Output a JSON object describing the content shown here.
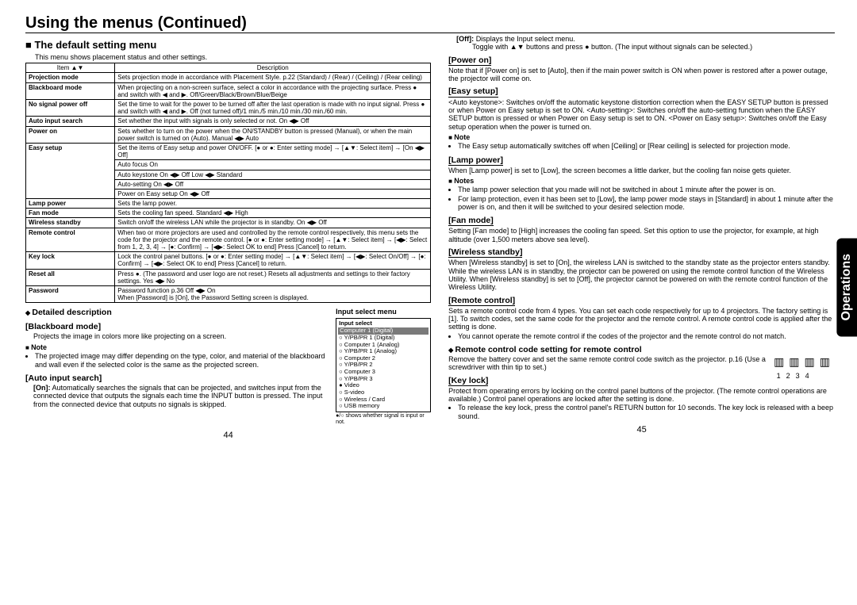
{
  "title": "Using the menus (Continued)",
  "section": "The default setting menu",
  "intro": "This menu shows placement status and other settings.",
  "thead_item": "Item ▲▼",
  "thead_desc": "Description",
  "rows": {
    "r0i": "Projection mode",
    "r0d": "Sets projection mode in accordance with Placement Style. p.22  (Standard) / (Rear) / (Ceiling) / (Rear ceiling)",
    "r1i": "Blackboard mode",
    "r1d": "When projecting on a non-screen surface, select a color in accordance with the projecting surface. Press ● and switch with ◀ and ▶. Off/Green/Black/Brown/Blue/Beige",
    "r2i": "No signal power off",
    "r2d": "Set the time to wait for the power to be turned off after the last operation is made with no input signal. Press ● and switch with ◀ and ▶. Off (not turned off)/1 min./5 min./10 min./30 min./60 min.",
    "r3i": "Auto input search",
    "r3d": "Set whether the input with signals is only selected or not.        On ◀▶ Off",
    "r4i": "Power on",
    "r4d": "Sets whether to turn on the power when the ON/STANDBY button is pressed (Manual), or when the main power switch is turned on (Auto).   Manual ◀▶ Auto",
    "r5i": "Easy setup",
    "r5d": "Set the items of Easy setup and power ON/OFF. [● or ●: Enter setting mode] → [▲▼: Select item] → [On ◀▶ Off]",
    "r5a": "Auto focus           On",
    "r5b": "Auto keystone     On ◀▶ Off              Low ◀▶ Standard",
    "r5c": "Auto-setting         On ◀▶ Off",
    "r5d2": "Power on Easy setup   On ◀▶ Off",
    "r6i": "Lamp power",
    "r6d": "Sets the lamp power.",
    "r7i": "Fan mode",
    "r7d": "Sets the cooling fan speed.                         Standard ◀▶ High",
    "r8i": "Wireless standby",
    "r8d": "Switch on/off the wireless LAN while the projector is in standby.    On ◀▶ Off",
    "r9i": "Remote control",
    "r9d": "When two or more projectors are used and controlled by the remote control respectively, this menu sets the code for the projector and the remote control. [● or ●: Enter setting mode] → [▲▼: Select item] → [◀▶: Select from 1, 2, 3, 4] → [●: Confirm] → [◀▶: Select OK to end] Press [Cancel] to return.",
    "r10i": "Key lock",
    "r10d": "Lock the control panel buttons. [● or ●: Enter setting mode] → [▲▼: Select item] → [◀▶: Select On/Off] → [●: Confirm] → [◀▶: Select OK to end] Press [Cancel] to return.",
    "r11i": "Reset all",
    "r11d": "Press ●. (The password and user logo are not reset.) Resets all adjustments and settings to their factory settings.   Yes ◀▶ No",
    "r12i": "Password",
    "r12d": "Password function p.36                                    Off ◀▶ On\nWhen [Password] is [On], the Password Setting screen is displayed."
  },
  "detdesc": "Detailed description",
  "bb": {
    "h": "[Blackboard mode]",
    "p": "Projects the image in colors more like projecting on a screen."
  },
  "noteh": "Note",
  "bb_note": "The projected image may differ depending on the type, color, and material of the blackboard and wall even if the selected color is the same as the projected screen.",
  "ais": {
    "h": "[Auto input search]",
    "on": "[On]:",
    "ont": "Automatically searches the signals that can be projected, and switches input from the connected device that outputs the signals each time the INPUT button is pressed. The input from the connected device that outputs no signals is skipped.",
    "off": "[Off]:",
    "offt": "Displays the Input select menu.",
    "toggle": "Toggle with ▲▼ buttons and press ● button. (The input without signals can be selected.)"
  },
  "inputmenu": {
    "title": "Input select menu",
    "hdr": "Input select",
    "i0": "Computer 1 (Digital)",
    "i1": "Y/PB/PR 1 (Digital)",
    "i2": "Computer 1 (Analog)",
    "i3": "Y/PB/PR 1 (Analog)",
    "i4": "Computer 2",
    "i5": "Y/PB/PR 2",
    "i6": "Computer 3",
    "i7": "Y/PB/PR 3",
    "i8": "Video",
    "i9": "S-video",
    "i10": "Wireless / Card",
    "i11": "USB memory",
    "foot": "●/○ shows whether signal is input or not."
  },
  "right": {
    "poweron": {
      "h": "[Power on]",
      "p": "Note that if [Power on] is set to [Auto], then if the main power switch is ON when power is restored after a power outage, the projector will come on."
    },
    "easy": {
      "h": "[Easy setup]",
      "p": "<Auto keystone>: Switches on/off the automatic keystone distortion correction when the EASY SETUP button is pressed or when Power on Easy setup is set to ON. <Auto-setting>: Switches on/off the auto-setting function when the EASY SETUP button is pressed or when Power on Easy setup is set to ON. <Power on Easy setup>: Switches on/off the Easy setup operation when the power is turned on.",
      "note": "The Easy setup automatically switches off when [Ceiling] or [Rear ceiling] is selected for projection mode."
    },
    "lamp": {
      "h": "[Lamp power]",
      "p": "When [Lamp power] is set to [Low], the screen becomes a little darker, but the cooling fan noise gets quieter.",
      "n1": "The lamp power selection that you made will not be switched in about 1 minute after the power is on.",
      "n2": "For lamp protection, even it has been set to [Low], the lamp power mode stays in [Standard] in about 1 minute after the power is on, and then it will be switched to your desired selection mode."
    },
    "fan": {
      "h": "[Fan mode]",
      "p": "Setting [Fan mode] to [High] increases the cooling fan speed. Set this option to use the projector, for example, at high altitude (over 1,500 meters above sea level)."
    },
    "wl": {
      "h": "[Wireless standby]",
      "p": "When [Wireless standby] is set to [On], the wireless LAN is switched to the standby state as the projector enters standby. While the wireless LAN is in standby, the projector can be powered on using the remote control function of the Wireless Utility. When [Wireless standby] is set to [Off], the projector cannot be powered on with the remote control function of the Wireless Utility."
    },
    "rc": {
      "h": "[Remote control]",
      "p": "Sets a remote control code from 4 types. You can set each code respectively for up to 4 projectors. The factory setting is [1]. To switch codes, set the same code for the projector and the remote control. A remote control code is applied after the setting is done.",
      "n": "You cannot operate the remote control if the codes of the projector and the remote control do not match."
    },
    "rcset": {
      "h": "Remote control code setting for remote control",
      "p": "Remove the battery cover and set the same remote control code switch as the projector. p.16  (Use a screwdriver with thin tip to set.)"
    },
    "kl": {
      "h": "[Key lock]",
      "p": "Protect from operating errors by locking on the control panel buttons of the projector. (The remote control operations are available.) Control panel operations are locked after the setting is done.",
      "n": "To release the key lock, press the control panel's RETURN button for 10 seconds. The key lock is released with a beep sound."
    }
  },
  "notes_h": "Notes",
  "sidetab": "Operations",
  "pL": "44",
  "pR": "45"
}
